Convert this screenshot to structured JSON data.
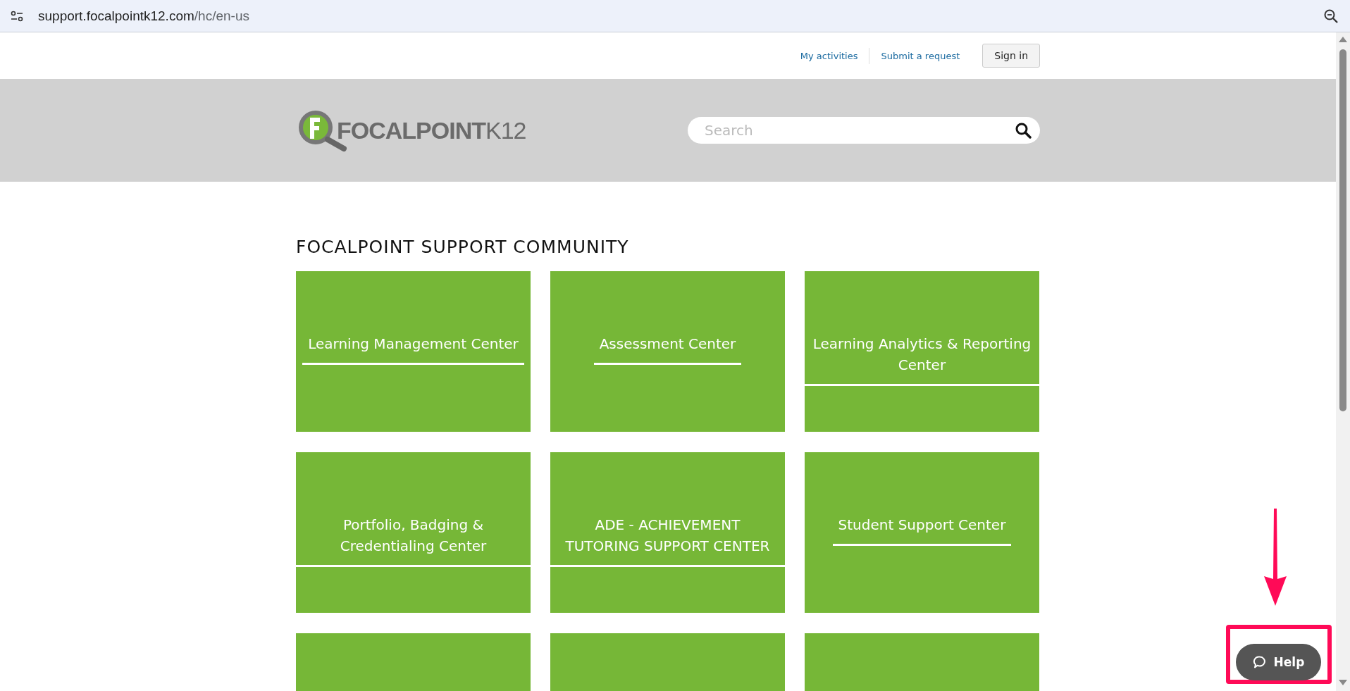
{
  "browser": {
    "url_host": "support.focalpointk12.com",
    "url_path": "/hc/en-us"
  },
  "top_nav": {
    "links": [
      "My activities",
      "Submit a request"
    ],
    "sign_in": "Sign in"
  },
  "header": {
    "logo_main": "FOCALPOINT",
    "logo_suffix": "K12",
    "search": {
      "placeholder": "Search"
    }
  },
  "section_title": "FOCALPOINT SUPPORT COMMUNITY",
  "tiles": [
    {
      "kind": "titled",
      "title": "Learning Management Center"
    },
    {
      "kind": "titled",
      "title": "Assessment Center"
    },
    {
      "kind": "titled",
      "title": "Learning Analytics & Reporting Center"
    },
    {
      "kind": "titled",
      "title": "Portfolio, Badging & Credentialing Center"
    },
    {
      "kind": "titled",
      "title": "ADE - ACHIEVEMENT TUTORING SUPPORT CENTER"
    },
    {
      "kind": "titled",
      "title": "Student Support Center"
    },
    {
      "kind": "cut_off"
    },
    {
      "kind": "cut_off"
    },
    {
      "kind": "cut_off"
    }
  ],
  "help_button": {
    "label": "Help"
  }
}
